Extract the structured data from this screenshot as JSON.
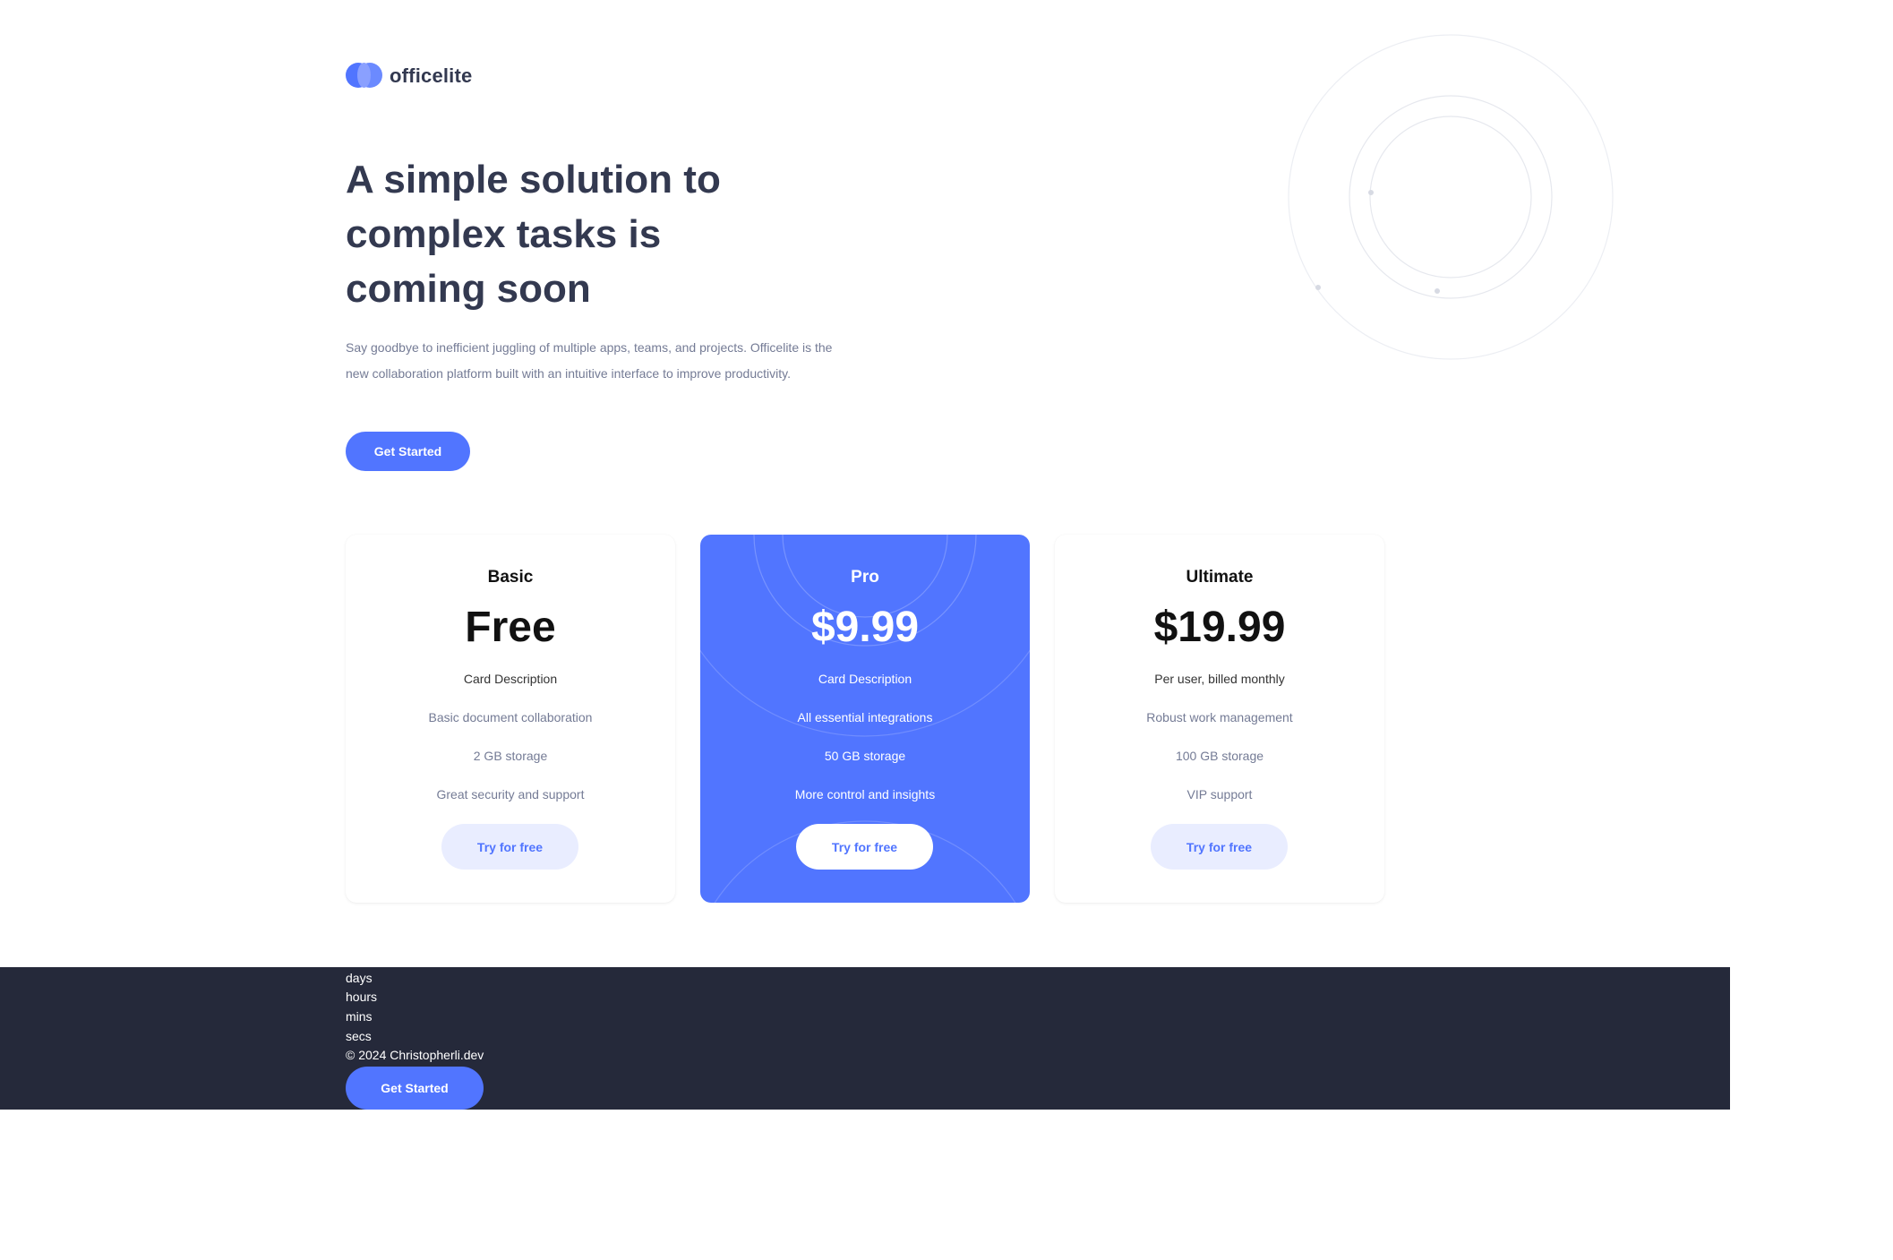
{
  "brand": {
    "name": "officelite"
  },
  "hero": {
    "title": "A simple solution to complex tasks is coming soon",
    "description": "Say goodbye to inefficient juggling of multiple apps, teams, and projects. Officelite is the new collaboration platform built with an intuitive interface to improve productivity.",
    "cta_label": "Get Started"
  },
  "plans": [
    {
      "tier": "Basic",
      "price": "Free",
      "subtitle": "Card Description",
      "features": [
        "Basic document collaboration",
        "2 GB storage",
        "Great security and support"
      ],
      "cta_label": "Try for free"
    },
    {
      "tier": "Pro",
      "price": "$9.99",
      "subtitle": "Card Description",
      "features": [
        "All essential integrations",
        "50 GB storage",
        "More control and insights"
      ],
      "cta_label": "Try for free"
    },
    {
      "tier": "Ultimate",
      "price": "$19.99",
      "subtitle": "Per user, billed monthly",
      "features": [
        "Robust work management",
        "100 GB storage",
        "VIP support"
      ],
      "cta_label": "Try for free"
    }
  ],
  "footer": {
    "units": [
      "days",
      "hours",
      "mins",
      "secs"
    ],
    "copyright": "© 2024 Christopherli.dev",
    "cta_label": "Get Started"
  },
  "colors": {
    "accent": "#5175ff",
    "heading": "#333950",
    "body_text": "#747b95",
    "light_button": "#e9edff",
    "footer_bg": "#25293a"
  }
}
